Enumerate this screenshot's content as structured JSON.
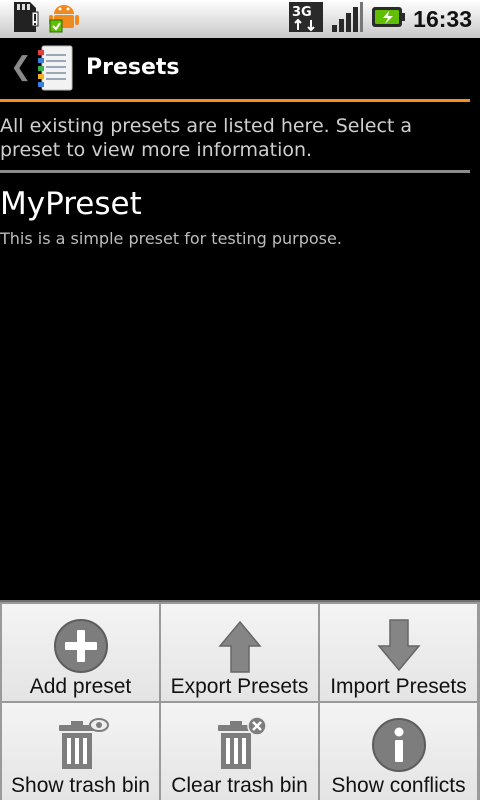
{
  "status_bar": {
    "time": "16:33",
    "network_label": "3G",
    "icons": [
      "sd-card-warning-icon",
      "android-debug-icon",
      "3g-data-icon",
      "signal-strength-icon",
      "battery-charging-icon"
    ]
  },
  "title_bar": {
    "title": "Presets"
  },
  "intro_text": "All existing presets are listed here. Select a preset to view more information.",
  "presets": [
    {
      "name": "MyPreset",
      "description": "This is a simple preset for testing purpose."
    }
  ],
  "menu": {
    "items": [
      {
        "label": "Add preset",
        "icon": "plus-circle-icon"
      },
      {
        "label": "Export Presets",
        "icon": "arrow-up-icon"
      },
      {
        "label": "Import Presets",
        "icon": "arrow-down-icon"
      },
      {
        "label": "Show trash bin",
        "icon": "trash-bin-view-icon"
      },
      {
        "label": "Clear trash bin",
        "icon": "trash-bin-clear-icon"
      },
      {
        "label": "Show conflicts",
        "icon": "info-circle-icon"
      }
    ]
  },
  "colors": {
    "accent_orange": "#f3921f",
    "background": "#000000",
    "menu_background": "#eeeeee",
    "icon_gray": "#808080",
    "battery_green": "#5fbf00"
  }
}
